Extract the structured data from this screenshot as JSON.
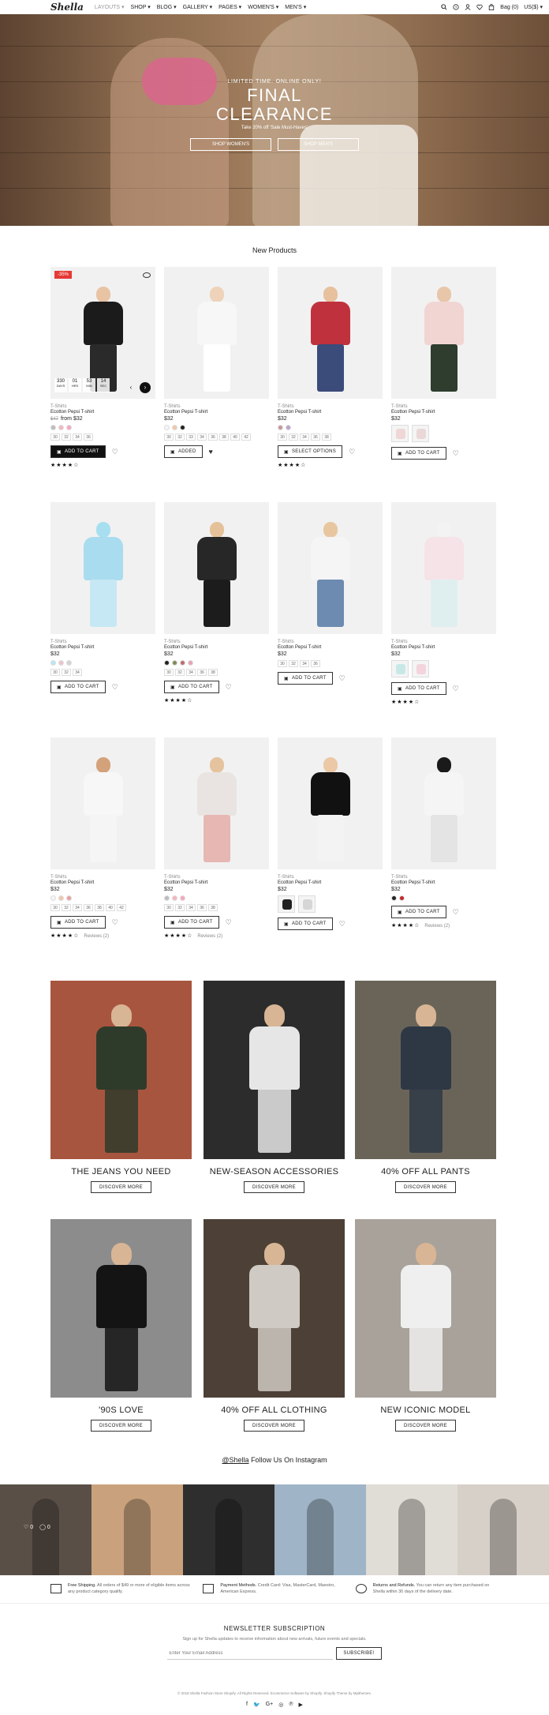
{
  "header": {
    "logo": "Shella",
    "nav": [
      "LAYOUTS ▾",
      "SHOP ▾",
      "BLOG ▾",
      "GALLERY ▾",
      "PAGES ▾",
      "WOMEN'S ▾",
      "MEN'S ▾"
    ],
    "bag": "Bag (0)",
    "currency": "US($) ▾"
  },
  "hero": {
    "kicker": "LIMITED TIME. ONLINE ONLY!",
    "title_line1": "FINAL",
    "title_line2": "CLEARANCE",
    "sub": "Take 20% off 'Sale Must-Haves'",
    "btn_women": "SHOP WOMEN'S",
    "btn_men": "SHOP MEN'S"
  },
  "products_title": "New Products",
  "products": [
    {
      "cat": "T-Shirts",
      "name": "Ecotton Pepsi T-shirt",
      "old": "$47",
      "price": "from $32",
      "badge": "-35%",
      "btn": "ADD TO CART",
      "btn_style": "black",
      "stars": "★★★★☆",
      "countdown": [
        [
          "330",
          "DAYS"
        ],
        [
          "01",
          "HRS"
        ],
        [
          "53",
          "MIN"
        ],
        [
          "14",
          "SEC"
        ]
      ],
      "swatches": [
        "#bdbdbd",
        "#f4b6bf",
        "#f7a8ba"
      ],
      "sizes": [
        "30",
        "32",
        "34",
        "36"
      ],
      "colors": {
        "head": "#e8c3a4",
        "torso": "#1b1b1b",
        "legs": "#2a2a2a"
      }
    },
    {
      "cat": "T-Shirts",
      "name": "Ecotton Pepsi T-shirt",
      "price": "$32",
      "btn": "ADDED",
      "btn_style": "white",
      "heart": "♥",
      "swatches": [
        "#f5f5f5",
        "#f2c7a9",
        "#222222"
      ],
      "sizes": [
        "30",
        "32",
        "33",
        "34",
        "36",
        "38",
        "40",
        "42"
      ],
      "colors": {
        "head": "#eed2b9",
        "torso": "#f7f7f7",
        "legs": "#ffffff"
      }
    },
    {
      "cat": "T-Shirts",
      "name": "Ecotton Pepsi T-shirt",
      "price": "$32",
      "btn": "SELECT OPTIONS",
      "btn_style": "white",
      "stars": "★★★★☆",
      "swatches": [
        "#c9979a",
        "#b9a4c9"
      ],
      "sizes": [
        "30",
        "32",
        "34",
        "36",
        "38"
      ],
      "colors": {
        "head": "#e7c09d",
        "torso": "#c0313e",
        "legs": "#3b4b7a"
      }
    },
    {
      "cat": "T-Shirts",
      "name": "Ecotton Pepsi T-shirt",
      "price": "$32",
      "btn": "ADD TO CART",
      "btn_style": "white",
      "thumbs": [
        "#f0d6d6",
        "#ead8d8"
      ],
      "colors": {
        "head": "#e8c6aa",
        "torso": "#f1d5d2",
        "legs": "#2e3d2e"
      }
    },
    {
      "cat": "T-Shirts",
      "name": "Ecotton Pepsi T-shirt",
      "price": "$32",
      "btn": "ADD TO CART",
      "btn_style": "white",
      "swatches": [
        "#b8e6f5",
        "#ebc3cb",
        "#d3d3d3"
      ],
      "sizes": [
        "30",
        "32",
        "34"
      ],
      "colors": {
        "head": "#a7dff0",
        "torso": "#a9dcef",
        "legs": "#c6e8f4"
      }
    },
    {
      "cat": "T-Shirts",
      "name": "Ecotton Pepsi T-shirt",
      "price": "$32",
      "btn": "ADD TO CART",
      "btn_style": "white",
      "stars": "★★★★☆",
      "swatches": [
        "#222222",
        "#7d8b56",
        "#c06c6c",
        "#e8a3b5"
      ],
      "sizes": [
        "30",
        "32",
        "34",
        "36",
        "38"
      ],
      "colors": {
        "head": "#e5c199",
        "torso": "#272727",
        "legs": "#1c1c1c"
      }
    },
    {
      "cat": "T-Shirts",
      "name": "Ecotton Pepsi T-shirt",
      "price": "$32",
      "btn": "ADD TO CART",
      "btn_style": "white",
      "sizes": [
        "30",
        "32",
        "34",
        "36"
      ],
      "colors": {
        "head": "#e8c6a0",
        "torso": "#f5f5f5",
        "legs": "#6d8ab0"
      }
    },
    {
      "cat": "T-Shirts",
      "name": "Ecotton Pepsi T-shirt",
      "price": "$32",
      "btn": "ADD TO CART",
      "btn_style": "white",
      "stars": "★★★★☆",
      "thumbs": [
        "#c6e9e7",
        "#f3d4dc"
      ],
      "colors": {
        "head": "#f3f3f3",
        "torso": "#f6e3e7",
        "legs": "#dfeff0"
      }
    },
    {
      "cat": "T-Shirts",
      "name": "Ecotton Pepsi T-shirt",
      "price": "$32",
      "btn": "ADD TO CART",
      "btn_style": "white",
      "stars": "★★★★☆",
      "reviews": "Reviews (2)",
      "swatches": [
        "#f5f5f5",
        "#f2c7a9",
        "#eaa0a0"
      ],
      "sizes": [
        "30",
        "32",
        "34",
        "36",
        "38",
        "40",
        "42"
      ],
      "colors": {
        "head": "#d4a27a",
        "torso": "#f7f7f7",
        "legs": "#f5f5f5"
      }
    },
    {
      "cat": "T-Shirts",
      "name": "Ecotton Pepsi T-shirt",
      "price": "$32",
      "btn": "ADD TO CART",
      "btn_style": "white",
      "stars": "★★★★☆",
      "reviews": "Reviews (2)",
      "swatches": [
        "#bdbdbd",
        "#f4b6bf",
        "#f7a8ba"
      ],
      "sizes": [
        "30",
        "32",
        "34",
        "36",
        "38"
      ],
      "colors": {
        "head": "#e5c39f",
        "torso": "#e9e4e1",
        "legs": "#e7b7b3"
      }
    },
    {
      "cat": "T-Shirts",
      "name": "Ecotton Pepsi T-shirt",
      "price": "$32",
      "btn": "ADD TO CART",
      "btn_style": "white",
      "thumbs": [
        "#222222",
        "#d6d6d6"
      ],
      "colors": {
        "head": "#ebc9a6",
        "torso": "#111111",
        "legs": "#f3f3f3"
      }
    },
    {
      "cat": "T-Shirts",
      "name": "Ecotton Pepsi T-shirt",
      "price": "$32",
      "btn": "ADD TO CART",
      "btn_style": "white",
      "stars": "★★★★☆",
      "reviews": "Reviews (2)",
      "swatches": [
        "#222222",
        "#c62828"
      ],
      "colors": {
        "head": "#1a1a1a",
        "torso": "#f5f5f5",
        "legs": "#e4e4e4"
      }
    }
  ],
  "collections": [
    {
      "title": "THE JEANS YOU NEED",
      "btn": "DISCOVER MORE",
      "bg": "#a8553f",
      "figure": "#2f3b2a"
    },
    {
      "title": "NEW-SEASON ACCESSORIES",
      "btn": "DISCOVER MORE",
      "bg": "#2c2c2c",
      "figure": "#e6e6e6"
    },
    {
      "title": "40% OFF ALL PANTS",
      "btn": "DISCOVER MORE",
      "bg": "#6a6458",
      "figure": "#2e3845"
    },
    {
      "title": "'90S LOVE",
      "btn": "DISCOVER MORE",
      "bg": "#8c8c8c",
      "figure": "#141414"
    },
    {
      "title": "40% OFF ALL CLOTHING",
      "btn": "DISCOVER MORE",
      "bg": "#4d4036",
      "figure": "#cfcac3"
    },
    {
      "title": "NEW ICONIC MODEL",
      "btn": "DISCOVER MORE",
      "bg": "#a9a29a",
      "figure": "#efefef"
    }
  ],
  "instagram": {
    "handle": "@Shella",
    "rest": "Follow Us On Instagram",
    "likes": "♡ 0",
    "comments": "◯ 0",
    "tiles": [
      "#5a4f47",
      "#c9a27d",
      "#2e2e2e",
      "#9fb4c6",
      "#e0dcd6",
      "#d7d0c8"
    ]
  },
  "features": [
    {
      "title": "Free Shipping.",
      "text": "All orders of $49 or more of eligible items across any product category qualify."
    },
    {
      "title": "Payment Methods.",
      "text": "Credit Card: Visa, MasterCard, Maestro, American Express."
    },
    {
      "title": "Returns and Refunds.",
      "text": "You can return any item purchased on Shella within 30 days of the delivery date."
    }
  ],
  "newsletter": {
    "title": "NEWSLETTER SUBSCRIPTION",
    "sub": "Sign up for Shella updates to receive information about new arrivals, future events and specials.",
    "placeholder": "Enter Your Email Address",
    "btn": "SUBSCRIBE!"
  },
  "footer": {
    "copyright": "© 2018 Shella Fashion Store Shopify. All Rights Reserved. Ecommerce Software by Shopify. Shopify Theme by Mpithemes.",
    "social": [
      "f",
      "🐦",
      "G+",
      "◎",
      "℗",
      "▶"
    ]
  }
}
